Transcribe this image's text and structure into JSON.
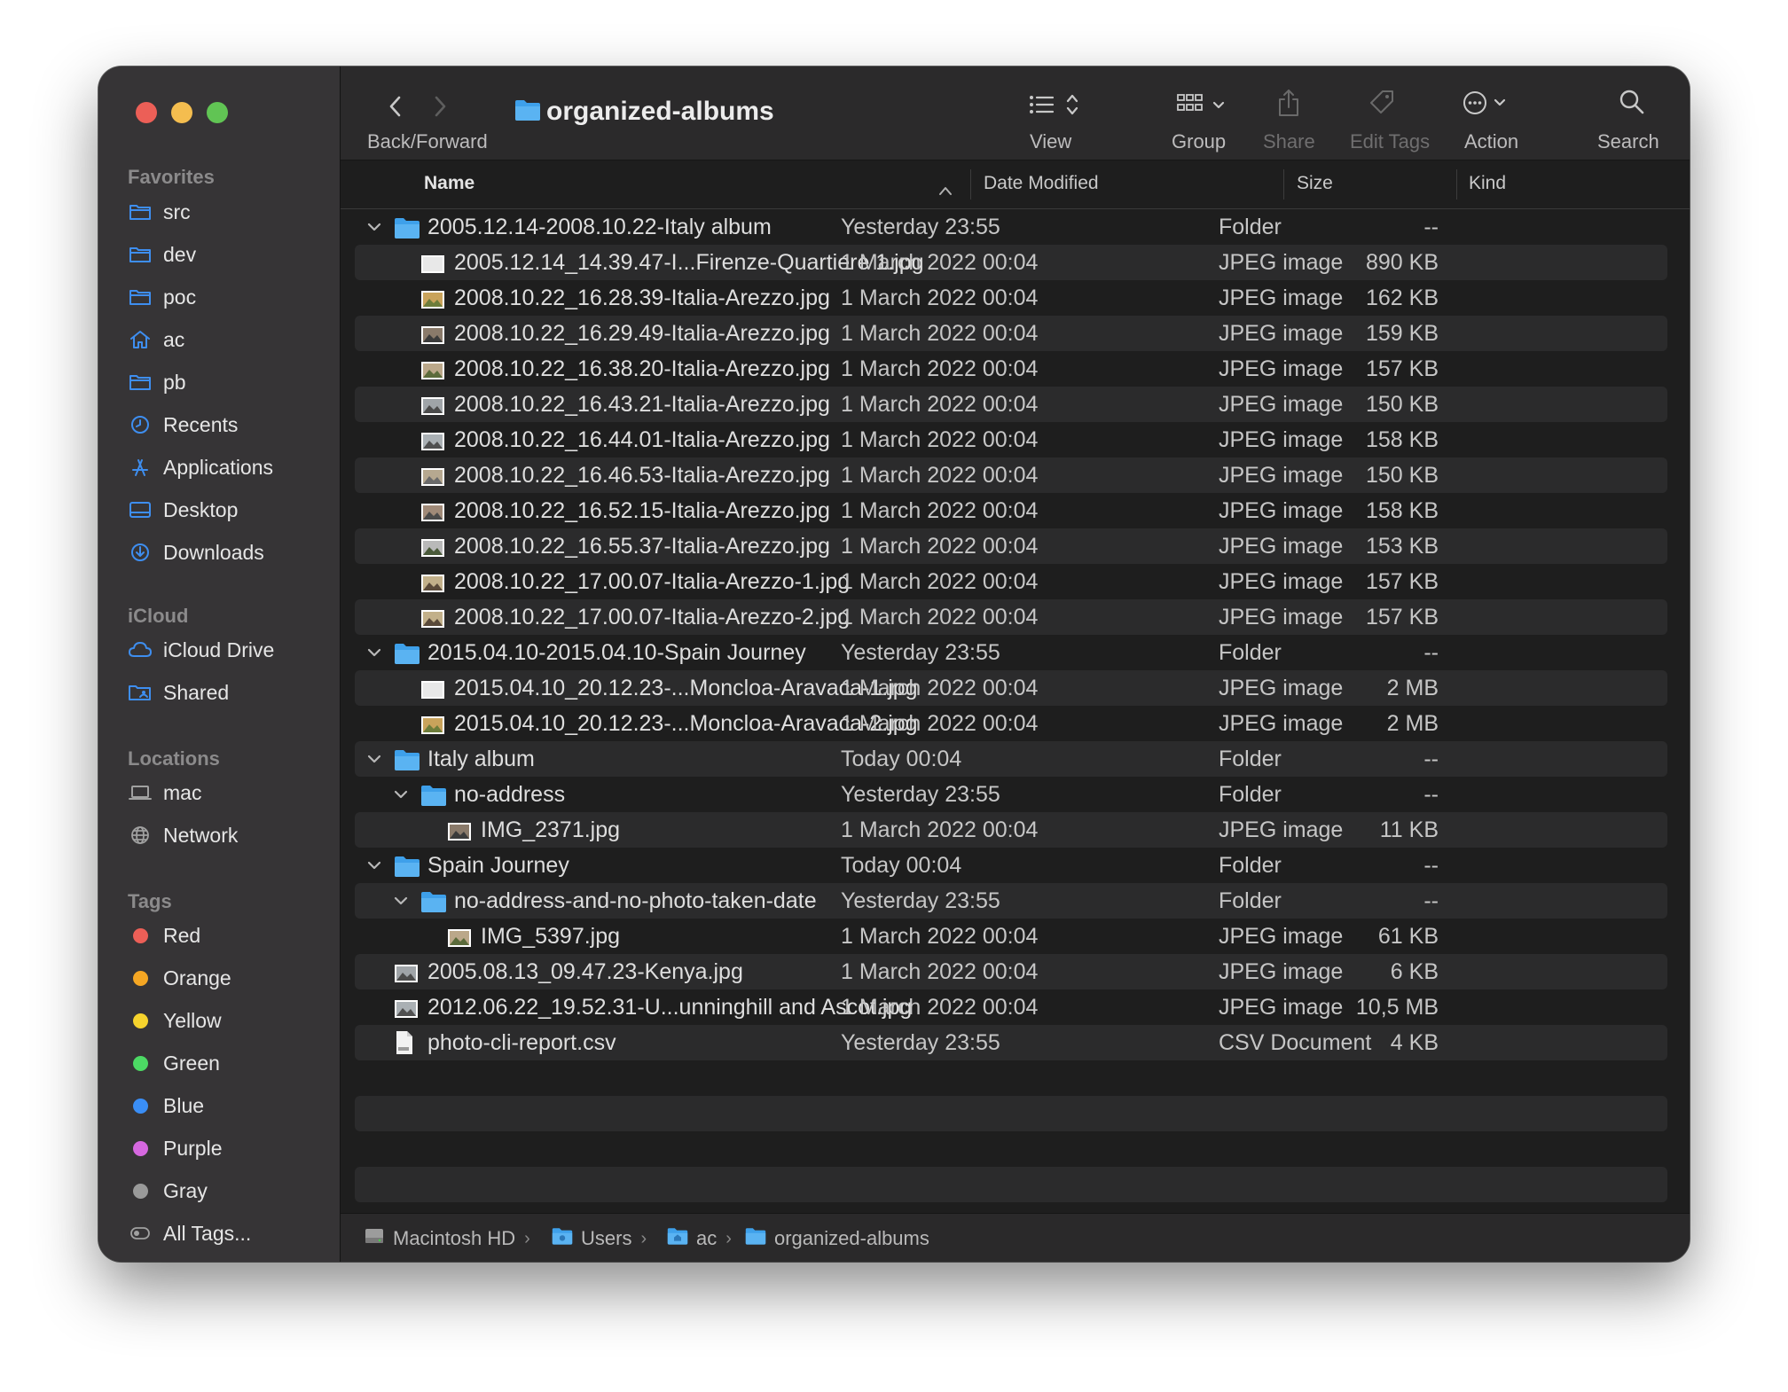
{
  "window": {
    "title": "organized-albums"
  },
  "traffic_lights": {
    "close": "#ec5f57",
    "minimize": "#f4bd4f",
    "zoom": "#61c454"
  },
  "sidebar": {
    "favorites_header": "Favorites",
    "favorites": [
      {
        "label": "src",
        "icon": "folder-icon"
      },
      {
        "label": "dev",
        "icon": "folder-icon"
      },
      {
        "label": "poc",
        "icon": "folder-icon"
      },
      {
        "label": "ac",
        "icon": "home-icon"
      },
      {
        "label": "pb",
        "icon": "folder-icon"
      },
      {
        "label": "Recents",
        "icon": "clock-icon"
      },
      {
        "label": "Applications",
        "icon": "applications-icon"
      },
      {
        "label": "Desktop",
        "icon": "desktop-icon"
      },
      {
        "label": "Downloads",
        "icon": "download-icon"
      }
    ],
    "icloud_header": "iCloud",
    "icloud": [
      {
        "label": "iCloud Drive",
        "icon": "cloud-icon"
      },
      {
        "label": "Shared",
        "icon": "shared-folder-icon"
      }
    ],
    "locations_header": "Locations",
    "locations": [
      {
        "label": "mac",
        "icon": "laptop-icon"
      },
      {
        "label": "Network",
        "icon": "globe-icon"
      }
    ],
    "tags_header": "Tags",
    "tags": [
      {
        "label": "Red",
        "color": "#ec5f57"
      },
      {
        "label": "Orange",
        "color": "#f5a623"
      },
      {
        "label": "Yellow",
        "color": "#f6d32d"
      },
      {
        "label": "Green",
        "color": "#4cd964"
      },
      {
        "label": "Blue",
        "color": "#3a8ef6"
      },
      {
        "label": "Purple",
        "color": "#d668e0"
      },
      {
        "label": "Gray",
        "color": "#9a9a9a"
      },
      {
        "label": "All Tags...",
        "color": ""
      }
    ]
  },
  "toolbar": {
    "back_forward": "Back/Forward",
    "view": "View",
    "group": "Group",
    "share": "Share",
    "edit_tags": "Edit Tags",
    "action": "Action",
    "search": "Search"
  },
  "columns": {
    "name": "Name",
    "date": "Date Modified",
    "size": "Size",
    "kind": "Kind"
  },
  "rows": [
    {
      "name": "2005.12.14-2008.10.22-Italy album",
      "date": "Yesterday 23:55",
      "size": "--",
      "kind": "Folder"
    },
    {
      "name": "2005.12.14_14.39.47-I...Firenze-Quartiere 1.jpg",
      "date": "1 March 2022 00:04",
      "size": "890 KB",
      "kind": "JPEG image"
    },
    {
      "name": "2008.10.22_16.28.39-Italia-Arezzo.jpg",
      "date": "1 March 2022 00:04",
      "size": "162 KB",
      "kind": "JPEG image"
    },
    {
      "name": "2008.10.22_16.29.49-Italia-Arezzo.jpg",
      "date": "1 March 2022 00:04",
      "size": "159 KB",
      "kind": "JPEG image"
    },
    {
      "name": "2008.10.22_16.38.20-Italia-Arezzo.jpg",
      "date": "1 March 2022 00:04",
      "size": "157 KB",
      "kind": "JPEG image"
    },
    {
      "name": "2008.10.22_16.43.21-Italia-Arezzo.jpg",
      "date": "1 March 2022 00:04",
      "size": "150 KB",
      "kind": "JPEG image"
    },
    {
      "name": "2008.10.22_16.44.01-Italia-Arezzo.jpg",
      "date": "1 March 2022 00:04",
      "size": "158 KB",
      "kind": "JPEG image"
    },
    {
      "name": "2008.10.22_16.46.53-Italia-Arezzo.jpg",
      "date": "1 March 2022 00:04",
      "size": "150 KB",
      "kind": "JPEG image"
    },
    {
      "name": "2008.10.22_16.52.15-Italia-Arezzo.jpg",
      "date": "1 March 2022 00:04",
      "size": "158 KB",
      "kind": "JPEG image"
    },
    {
      "name": "2008.10.22_16.55.37-Italia-Arezzo.jpg",
      "date": "1 March 2022 00:04",
      "size": "153 KB",
      "kind": "JPEG image"
    },
    {
      "name": "2008.10.22_17.00.07-Italia-Arezzo-1.jpg",
      "date": "1 March 2022 00:04",
      "size": "157 KB",
      "kind": "JPEG image"
    },
    {
      "name": "2008.10.22_17.00.07-Italia-Arezzo-2.jpg",
      "date": "1 March 2022 00:04",
      "size": "157 KB",
      "kind": "JPEG image"
    },
    {
      "name": "2015.04.10-2015.04.10-Spain Journey",
      "date": "Yesterday 23:55",
      "size": "--",
      "kind": "Folder"
    },
    {
      "name": "2015.04.10_20.12.23-...Moncloa-Aravaca-1.jpg",
      "date": "1 March 2022 00:04",
      "size": "2 MB",
      "kind": "JPEG image"
    },
    {
      "name": "2015.04.10_20.12.23-...Moncloa-Aravaca-2.jpg",
      "date": "1 March 2022 00:04",
      "size": "2 MB",
      "kind": "JPEG image"
    },
    {
      "name": "Italy album",
      "date": "Today 00:04",
      "size": "--",
      "kind": "Folder"
    },
    {
      "name": "no-address",
      "date": "Yesterday 23:55",
      "size": "--",
      "kind": "Folder"
    },
    {
      "name": "IMG_2371.jpg",
      "date": "1 March 2022 00:04",
      "size": "11 KB",
      "kind": "JPEG image"
    },
    {
      "name": "Spain Journey",
      "date": "Today 00:04",
      "size": "--",
      "kind": "Folder"
    },
    {
      "name": "no-address-and-no-photo-taken-date",
      "date": "Yesterday 23:55",
      "size": "--",
      "kind": "Folder"
    },
    {
      "name": "IMG_5397.jpg",
      "date": "1 March 2022 00:04",
      "size": "61 KB",
      "kind": "JPEG image"
    },
    {
      "name": "2005.08.13_09.47.23-Kenya.jpg",
      "date": "1 March 2022 00:04",
      "size": "6 KB",
      "kind": "JPEG image"
    },
    {
      "name": "2012.06.22_19.52.31-U...unninghill and Ascot.jpg",
      "date": "1 March 2022 00:04",
      "size": "10,5 MB",
      "kind": "JPEG image"
    },
    {
      "name": "photo-cli-report.csv",
      "date": "Yesterday 23:55",
      "size": "4 KB",
      "kind": "CSV Document"
    }
  ],
  "pathbar": [
    "Macintosh HD",
    "Users",
    "ac",
    "organized-albums"
  ]
}
